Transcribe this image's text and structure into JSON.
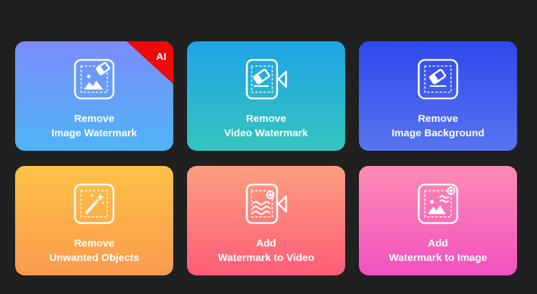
{
  "tools": [
    {
      "line1": "Remove",
      "line2": "Image Watermark",
      "icon": "image-eraser-icon",
      "badge": "AI"
    },
    {
      "line1": "Remove",
      "line2": "Video Watermark",
      "icon": "video-eraser-icon"
    },
    {
      "line1": "Remove",
      "line2": "Image Background",
      "icon": "background-eraser-icon"
    },
    {
      "line1": "Remove",
      "line2": "Unwanted Objects",
      "icon": "magic-wand-icon"
    },
    {
      "line1": "Add",
      "line2": "Watermark to Video",
      "icon": "video-watermark-add-icon"
    },
    {
      "line1": "Add",
      "line2": "Watermark to Image",
      "icon": "image-watermark-add-icon"
    }
  ],
  "colors": {
    "background": "#202020",
    "ai_badge": "#ee0a0a"
  }
}
